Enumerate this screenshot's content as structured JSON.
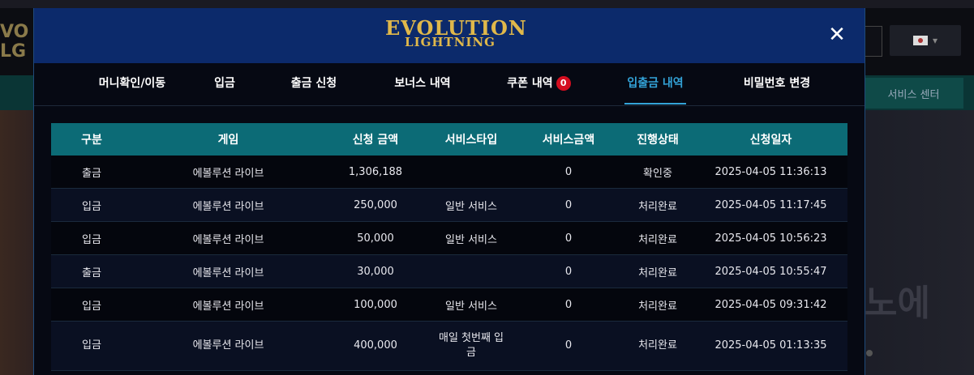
{
  "background": {
    "service_center": "서비스 센터",
    "hero_text": "노에"
  },
  "modal": {
    "brand_line1": "EVOLUTION",
    "brand_line2": "LIGHTNING",
    "close_icon": "close-icon"
  },
  "tabs": [
    {
      "label": "머니확인/이동"
    },
    {
      "label": "입금"
    },
    {
      "label": "출금 신청"
    },
    {
      "label": "보너스 내역"
    },
    {
      "label": "쿠폰 내역",
      "badge": "0"
    },
    {
      "label": "입출금 내역",
      "active": true
    },
    {
      "label": "비밀번호 변경"
    }
  ],
  "table": {
    "headers": [
      "구분",
      "게임",
      "신청 금액",
      "서비스타입",
      "서비스금액",
      "진행상태",
      "신청일자"
    ],
    "rows": [
      [
        "출금",
        "에볼루션 라이브",
        "1,306,188",
        "",
        "0",
        "확인중",
        "2025-04-05 11:36:13"
      ],
      [
        "입금",
        "에볼루션 라이브",
        "250,000",
        "일반 서비스",
        "0",
        "처리완료",
        "2025-04-05 11:17:45"
      ],
      [
        "입금",
        "에볼루션 라이브",
        "50,000",
        "일반 서비스",
        "0",
        "처리완료",
        "2025-04-05 10:56:23"
      ],
      [
        "출금",
        "에볼루션 라이브",
        "30,000",
        "",
        "0",
        "처리완료",
        "2025-04-05 10:55:47"
      ],
      [
        "입금",
        "에볼루션 라이브",
        "100,000",
        "일반 서비스",
        "0",
        "처리완료",
        "2025-04-05 09:31:42"
      ],
      [
        "입금",
        "에볼루션 라이브",
        "400,000",
        "매일 첫번째 입금",
        "0",
        "처리완료",
        "2025-04-05 01:13:35"
      ]
    ]
  },
  "colors": {
    "modal_header": "#0c2a6b",
    "table_header": "#0c6b76",
    "active_tab": "#33a3d8",
    "badge": "#d40d1f",
    "brand_gold": "#e0b84a"
  }
}
